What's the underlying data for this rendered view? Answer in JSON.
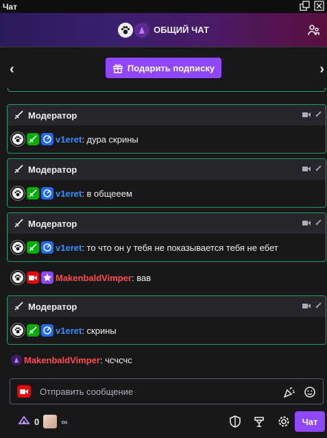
{
  "window": {
    "title": "Чат"
  },
  "header": {
    "title": "ОБЩИЙ ЧАТ"
  },
  "promo": {
    "button_label": "Подарить подписку"
  },
  "messages": [
    {
      "type": "mod",
      "header": "Модератор",
      "user": "v1eret",
      "text": ": дура скрины"
    },
    {
      "type": "mod",
      "header": "Модератор",
      "user": "v1eret",
      "text": ": в общееем"
    },
    {
      "type": "mod",
      "header": "Модератор",
      "user": "v1eret",
      "text": ": то что он у тебя не показывается тебя не ебет"
    },
    {
      "type": "plain",
      "user": "MakenbaldVimper",
      "text": ": вав"
    },
    {
      "type": "mod",
      "header": "Модератор",
      "user": "v1eret",
      "text": ": скрины"
    },
    {
      "type": "plain",
      "user": "MakenbaldVimper",
      "text": ": чсчсчс"
    }
  ],
  "input": {
    "placeholder": "Отправить сообщение"
  },
  "footer": {
    "points": "0",
    "infinity": "∞",
    "chat_button": "Чат"
  },
  "colors": {
    "accent": "#9147ff",
    "mod_border": "#1f9f63",
    "user_blue": "#2e91ff",
    "user_red": "#ff4a4a"
  }
}
